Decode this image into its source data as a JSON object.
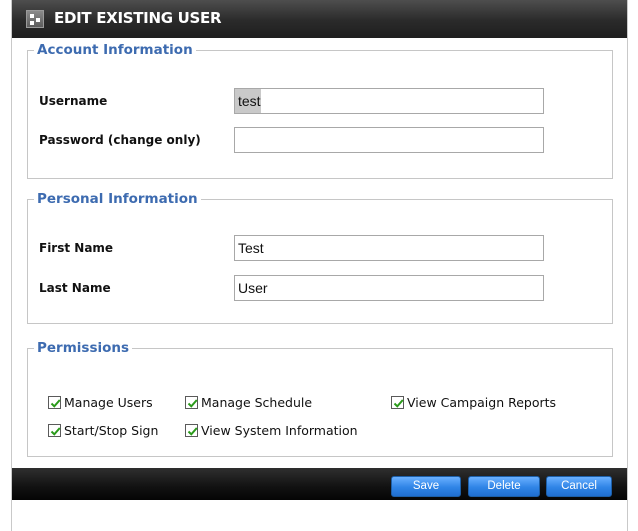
{
  "dialog": {
    "title": "EDIT EXISTING USER"
  },
  "account": {
    "legend": "Account Information",
    "username_label": "Username",
    "username_value": "test",
    "password_label": "Password (change only)",
    "password_value": ""
  },
  "personal": {
    "legend": "Personal Information",
    "first_name_label": "First Name",
    "first_name_value": "Test",
    "last_name_label": "Last Name",
    "last_name_value": "User"
  },
  "permissions": {
    "legend": "Permissions",
    "items": [
      {
        "label": "Manage Users",
        "checked": true
      },
      {
        "label": "Manage Schedule",
        "checked": true
      },
      {
        "label": "View Campaign Reports",
        "checked": true
      },
      {
        "label": "Start/Stop Sign",
        "checked": true
      },
      {
        "label": "View System Information",
        "checked": true
      }
    ]
  },
  "footer": {
    "save_label": "Save",
    "delete_label": "Delete",
    "cancel_label": "Cancel"
  },
  "colors": {
    "legend": "#3d6bb0",
    "button": "#2f84e6",
    "checkmark": "#2a9a1a"
  }
}
